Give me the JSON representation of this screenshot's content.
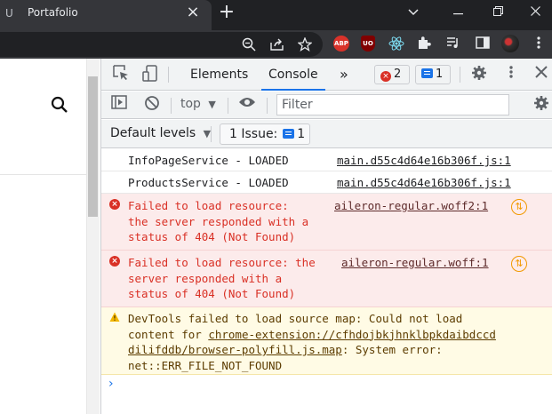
{
  "browser": {
    "tab_title": "Portafolio",
    "tab_favicon": "U"
  },
  "extensions": {
    "abp_label": "ABP",
    "ublock_label": "UO"
  },
  "devtools": {
    "tabs": [
      {
        "label": "Elements"
      },
      {
        "label": "Console"
      }
    ],
    "more_tabs": "»",
    "error_count": "2",
    "message_count": "1",
    "context": "top",
    "filter_placeholder": "Filter",
    "levels_label": "Default levels",
    "issues_label": "1 Issue:",
    "issues_count": "1"
  },
  "console": {
    "messages": [
      {
        "type": "info",
        "text": "InfoPageService - LOADED",
        "source": "main.d55c4d64e16b306f.js:1"
      },
      {
        "type": "info",
        "text": "ProductsService - LOADED",
        "source": "main.d55c4d64e16b306f.js:1"
      },
      {
        "type": "error",
        "text": "Failed to load resource:\nthe server responded with a\nstatus of 404 (Not Found)",
        "source": "aileron-regular.woff2:1"
      },
      {
        "type": "error",
        "text": "Failed to load resource: the\nserver responded with a\nstatus of 404 (Not Found)",
        "source": "aileron-regular.woff:1"
      },
      {
        "type": "warning",
        "line1": "DevTools failed to load source map: Could not load",
        "line2_prefix": "content for ",
        "link_a": "chrome-extension://cfhdojbkjhnklbpkdaibdccd",
        "link_b": "dilifddb/browser-polyfill.js.map",
        "line3_suffix": ": System error:",
        "line4": "net::ERR_FILE_NOT_FOUND"
      }
    ],
    "prompt_symbol": "›"
  }
}
